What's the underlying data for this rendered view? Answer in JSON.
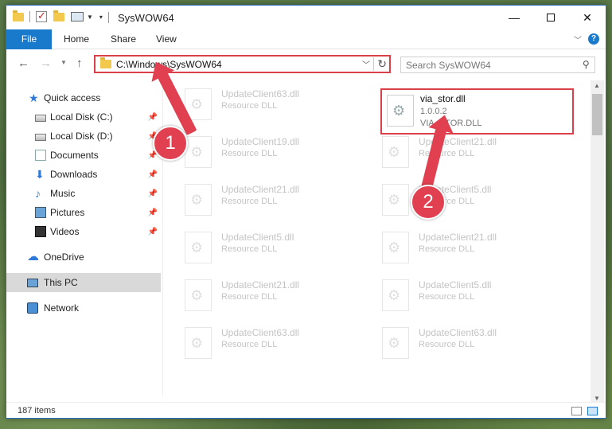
{
  "window": {
    "title": "SysWOW64"
  },
  "ribbon": {
    "tabs": [
      "File",
      "Home",
      "Share",
      "View"
    ]
  },
  "address": {
    "path": "C:\\Windows\\SysWOW64"
  },
  "search": {
    "placeholder": "Search SysWOW64"
  },
  "sidebar": {
    "items": [
      {
        "label": "Quick access",
        "icon": "quick-access-star-icon"
      },
      {
        "label": "Local Disk (C:)",
        "icon": "disk-icon",
        "pinned": true
      },
      {
        "label": "Local Disk (D:)",
        "icon": "disk-icon",
        "pinned": true
      },
      {
        "label": "Documents",
        "icon": "documents-icon",
        "pinned": true
      },
      {
        "label": "Downloads",
        "icon": "downloads-icon",
        "pinned": true
      },
      {
        "label": "Music",
        "icon": "music-icon",
        "pinned": true
      },
      {
        "label": "Pictures",
        "icon": "pictures-icon",
        "pinned": true
      },
      {
        "label": "Videos",
        "icon": "videos-icon",
        "pinned": true
      },
      {
        "label": "OneDrive",
        "icon": "onedrive-icon"
      },
      {
        "label": "This PC",
        "icon": "this-pc-icon",
        "selected": true
      },
      {
        "label": "Network",
        "icon": "network-icon"
      }
    ]
  },
  "files": {
    "left": [
      {
        "name": "UpdateClient63.dll",
        "type": "Resource DLL"
      },
      {
        "name": "UpdateClient19.dll",
        "type": "Resource DLL"
      },
      {
        "name": "UpdateClient21.dll",
        "type": "Resource DLL"
      },
      {
        "name": "UpdateClient5.dll",
        "type": "Resource DLL"
      },
      {
        "name": "UpdateClient21.dll",
        "type": "Resource DLL"
      },
      {
        "name": "UpdateClient63.dll",
        "type": "Resource DLL"
      }
    ],
    "right": [
      {
        "name": "UpdateClient21.dll",
        "type": "Resource DLL"
      },
      {
        "name": "UpdateClient5.dll",
        "type": "Resource DLL"
      },
      {
        "name": "UpdateClient21.dll",
        "type": "Resource DLL"
      },
      {
        "name": "UpdateClient5.dll",
        "type": "Resource DLL"
      },
      {
        "name": "UpdateClient63.dll",
        "type": "Resource DLL"
      }
    ],
    "highlighted": {
      "name": "via_stor.dll",
      "version": "1.0.0.2",
      "description": "VIA_STOR.DLL"
    }
  },
  "status": {
    "items_count": "187 items"
  },
  "annotations": {
    "badge1": "1",
    "badge2": "2",
    "color": "#e04050"
  }
}
